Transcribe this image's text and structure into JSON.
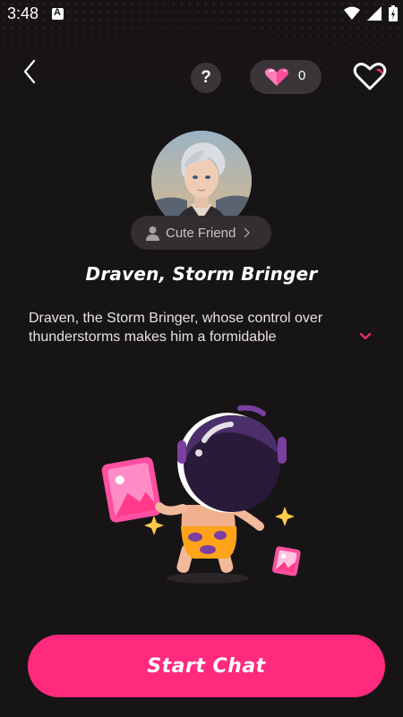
{
  "status_bar": {
    "time": "3:48"
  },
  "header": {
    "help_label": "?",
    "gem_count": "0"
  },
  "character": {
    "tag": "Cute Friend",
    "name": "Draven, Storm Bringer",
    "description": "Draven, the Storm Bringer, whose control over thunderstorms makes him a formidable"
  },
  "cta": {
    "start_chat": "Start Chat"
  },
  "colors": {
    "accent": "#ff2a7d",
    "background": "#171416",
    "chip": "#3a3538"
  }
}
